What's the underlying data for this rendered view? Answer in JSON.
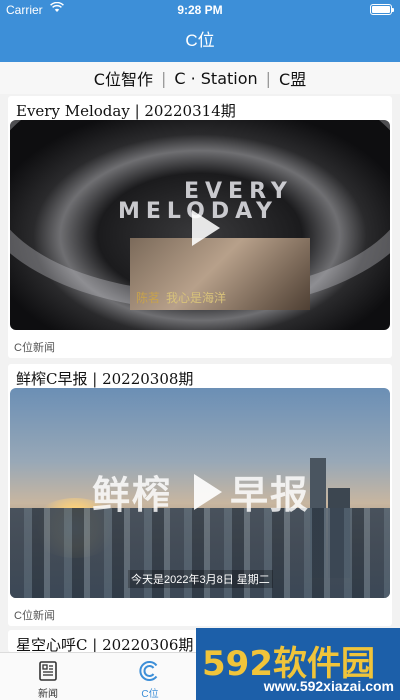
{
  "status_bar": {
    "carrier": "Carrier",
    "time": "9:28 PM"
  },
  "nav": {
    "title": "C位"
  },
  "segments": {
    "items": [
      "C位智作",
      "C · Station",
      "C盟"
    ]
  },
  "articles": [
    {
      "title": "Every Meloday | 20220314期",
      "source": "C位新闻",
      "thumb_wordmark_line1": "EVERY",
      "thumb_wordmark_line2": "MELODAY",
      "album_tag": "陈茗",
      "album_text": "我心是海洋"
    },
    {
      "title": "鲜榨C早报 | 20220308期",
      "source": "C位新闻",
      "thumb_brand_left": "鲜榨",
      "thumb_brand_right": "早报",
      "thumb_caption": "今天是2022年3月8日  星期二"
    },
    {
      "title": "星空心呼C | 20220306期"
    }
  ],
  "tabs": [
    {
      "label": "新闻",
      "icon": "newspaper-icon",
      "active": false
    },
    {
      "label": "C位",
      "icon": "c-logo-icon",
      "active": true
    }
  ],
  "watermark": {
    "main": "592软件园",
    "url": "www.592xiazai.com"
  },
  "colors": {
    "accent": "#3d8fd8",
    "watermark_bg": "#1c5fa9",
    "watermark_text": "#f0c43a"
  }
}
